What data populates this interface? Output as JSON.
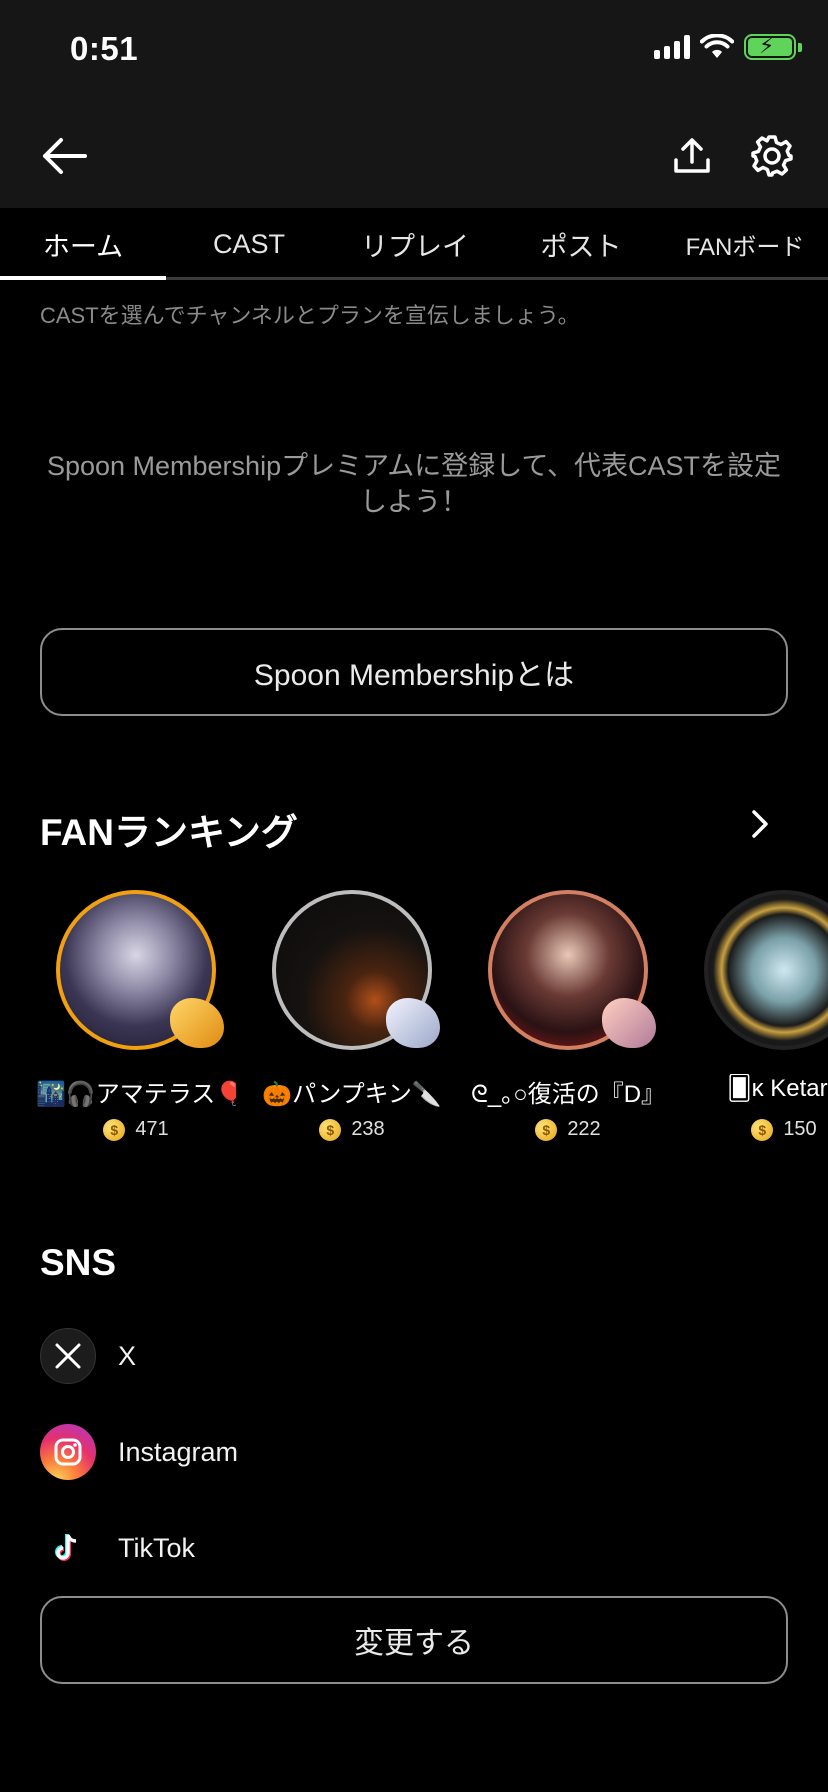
{
  "status": {
    "time": "0:51"
  },
  "tabs": [
    {
      "label": "ホーム",
      "active": true
    },
    {
      "label": "CAST",
      "active": false
    },
    {
      "label": "リプレイ",
      "active": false
    },
    {
      "label": "ポスト",
      "active": false
    },
    {
      "label": "FANボード",
      "active": false
    }
  ],
  "cast_section": {
    "hint": "CASTを選んでチャンネルとプランを宣伝しましょう。",
    "promo_line1": "Spoon Membershipプレミアムに登録して、代表CASTを設定",
    "promo_line2": "しよう！",
    "membership_button": "Spoon Membershipとは"
  },
  "fan_ranking": {
    "title": "FANランキング",
    "fans": [
      {
        "name": "🌃🎧アマテラス🎈",
        "coins": "471",
        "ring": "#f0a010"
      },
      {
        "name": "🎃パンプキン🔪",
        "coins": "238",
        "ring": "#bdbdbd"
      },
      {
        "name": "ᘓ_｡○復活の『D』",
        "coins": "222",
        "ring": "#d27f62"
      },
      {
        "name": "🂠κ Ketaro",
        "coins": "150",
        "ring": "#222222"
      }
    ]
  },
  "sns": {
    "title": "SNS",
    "items": [
      {
        "label": "X"
      },
      {
        "label": "Instagram"
      },
      {
        "label": "TikTok"
      }
    ],
    "change_button": "変更する"
  }
}
